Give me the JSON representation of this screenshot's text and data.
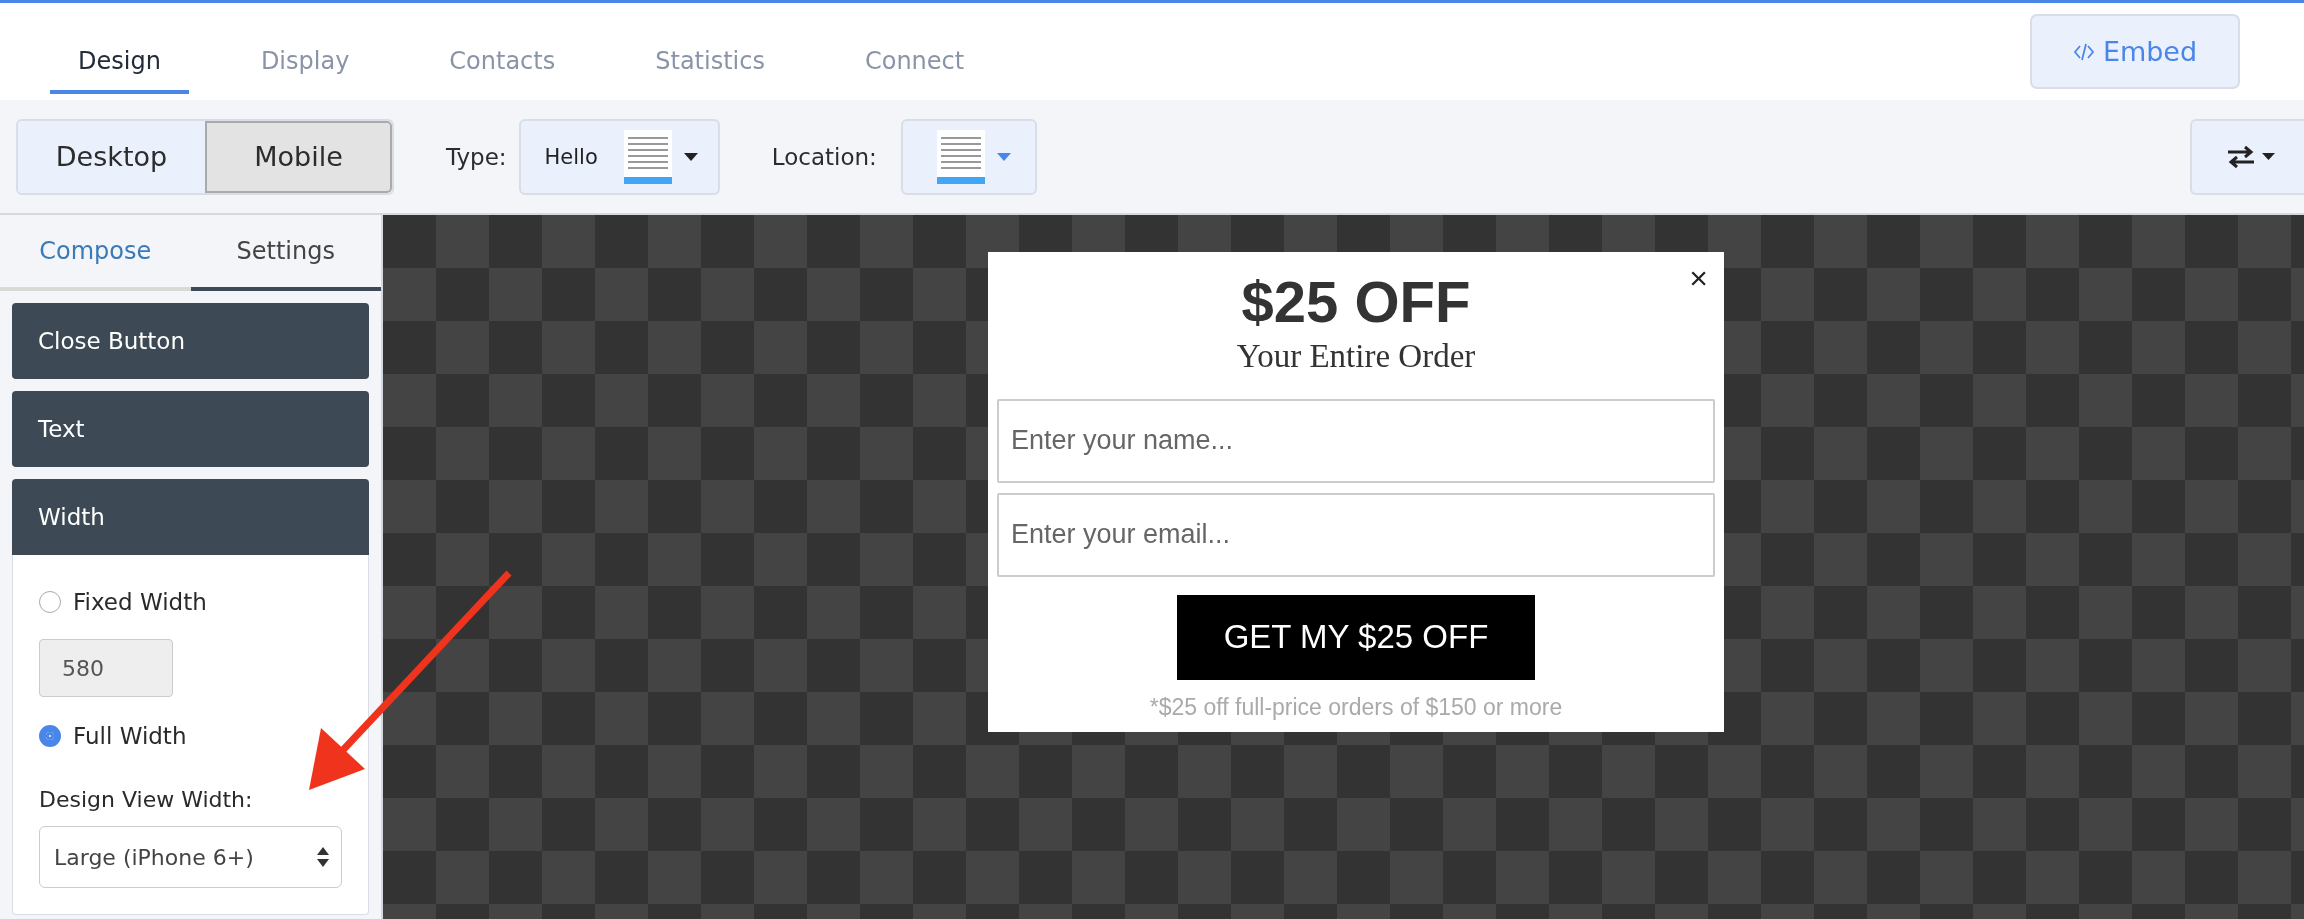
{
  "tabs": [
    {
      "label": "Design",
      "selected": true
    },
    {
      "label": "Display",
      "selected": false
    },
    {
      "label": "Contacts",
      "selected": false
    },
    {
      "label": "Statistics",
      "selected": false
    },
    {
      "label": "Connect",
      "selected": false
    }
  ],
  "embed_button": {
    "label": "Embed"
  },
  "toolbar": {
    "view_toggle": [
      {
        "label": "Desktop",
        "selected": false
      },
      {
        "label": "Mobile",
        "selected": true
      }
    ],
    "type_label": "Type:",
    "type_value": "Hello",
    "location_label": "Location:"
  },
  "sidebar": {
    "tabs": [
      {
        "label": "Compose",
        "selected": false
      },
      {
        "label": "Settings",
        "selected": true
      }
    ],
    "sections": [
      {
        "title": "Close Button",
        "expanded": false
      },
      {
        "title": "Text",
        "expanded": false
      },
      {
        "title": "Width",
        "expanded": true
      }
    ],
    "width_options": [
      {
        "label": "Fixed Width",
        "selected": false
      },
      {
        "label": "Full Width",
        "selected": true
      }
    ],
    "fixed_width": {
      "value": "580",
      "disabled": true
    },
    "design_view_label": "Design View Width:",
    "design_view_value": "Large (iPhone 6+)"
  },
  "popup": {
    "close": "×",
    "headline": "$25 OFF",
    "subheadline": "Your Entire Order",
    "name_placeholder": "Enter your name...",
    "email_placeholder": "Enter your email...",
    "button": "GET MY $25 OFF",
    "footnote": "*$25 off full-price orders of $150 or more"
  }
}
